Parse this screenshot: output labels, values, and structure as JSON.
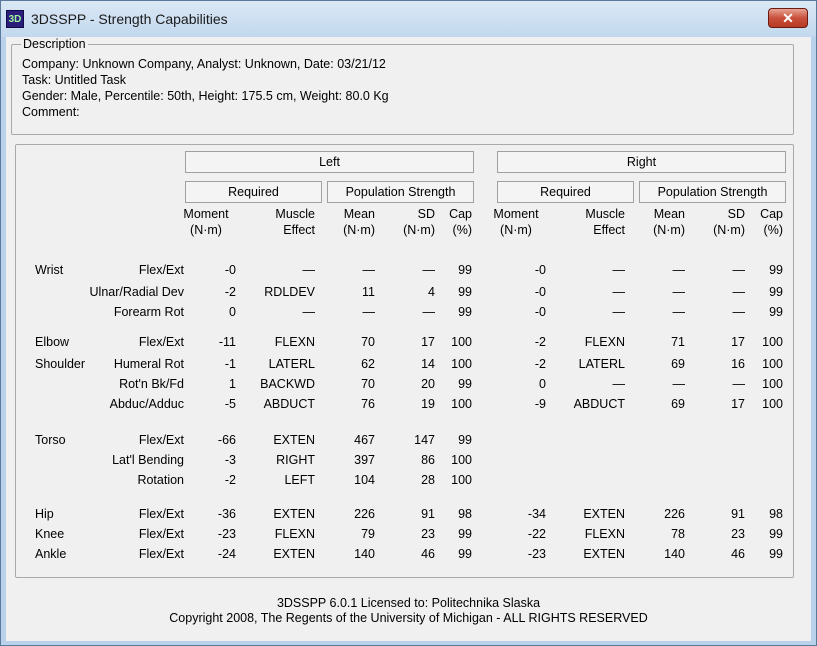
{
  "window": {
    "icon_text": "3D",
    "title": "3DSSPP - Strength Capabilities",
    "close_glyph": "✕"
  },
  "description": {
    "legend": "Description",
    "company_line": "Company: Unknown Company, Analyst: Unknown, Date: 03/21/12",
    "task_line": "Task: Untitled Task",
    "gender_line": "Gender: Male, Percentile: 50th, Height: 175.5 cm, Weight: 80.0 Kg",
    "comment_line": "Comment:"
  },
  "table": {
    "left_label": "Left",
    "right_label": "Right",
    "required_label": "Required",
    "population_label": "Population Strength",
    "col_headers": [
      [
        "Moment",
        "(N·m)"
      ],
      [
        "Muscle",
        "Effect"
      ],
      [
        "Mean",
        "(N·m)"
      ],
      [
        "SD",
        "(N·m)"
      ],
      [
        "Cap",
        "(%)"
      ]
    ],
    "rows": [
      {
        "joint": "Wrist",
        "motion": "Flex/Ext",
        "left": [
          "-0",
          "—",
          "—",
          "—",
          "99"
        ],
        "right": [
          "-0",
          "—",
          "—",
          "—",
          "99"
        ]
      },
      {
        "joint": "",
        "motion": "Ulnar/Radial Dev",
        "left": [
          "-2",
          "RDLDEV",
          "11",
          "4",
          "99"
        ],
        "right": [
          "-0",
          "—",
          "—",
          "—",
          "99"
        ]
      },
      {
        "joint": "",
        "motion": "Forearm Rot",
        "left": [
          "0",
          "—",
          "—",
          "—",
          "99"
        ],
        "right": [
          "-0",
          "—",
          "—",
          "—",
          "99"
        ]
      },
      {
        "joint": "Elbow",
        "motion": "Flex/Ext",
        "left": [
          "-11",
          "FLEXN",
          "70",
          "17",
          "100"
        ],
        "right": [
          "-2",
          "FLEXN",
          "71",
          "17",
          "100"
        ]
      },
      {
        "joint": "Shoulder",
        "motion": "Humeral Rot",
        "left": [
          "-1",
          "LATERL",
          "62",
          "14",
          "100"
        ],
        "right": [
          "-2",
          "LATERL",
          "69",
          "16",
          "100"
        ]
      },
      {
        "joint": "",
        "motion": "Rot'n Bk/Fd",
        "left": [
          "1",
          "BACKWD",
          "70",
          "20",
          "99"
        ],
        "right": [
          "0",
          "—",
          "—",
          "—",
          "100"
        ]
      },
      {
        "joint": "",
        "motion": "Abduc/Adduc",
        "left": [
          "-5",
          "ABDUCT",
          "76",
          "19",
          "100"
        ],
        "right": [
          "-9",
          "ABDUCT",
          "69",
          "17",
          "100"
        ]
      },
      {
        "joint": "Torso",
        "motion": "Flex/Ext",
        "left": [
          "-66",
          "EXTEN",
          "467",
          "147",
          "99"
        ],
        "right": [
          "",
          "",
          "",
          "",
          ""
        ]
      },
      {
        "joint": "",
        "motion": "Lat'l Bending",
        "left": [
          "-3",
          "RIGHT",
          "397",
          "86",
          "100"
        ],
        "right": [
          "",
          "",
          "",
          "",
          ""
        ]
      },
      {
        "joint": "",
        "motion": "Rotation",
        "left": [
          "-2",
          "LEFT",
          "104",
          "28",
          "100"
        ],
        "right": [
          "",
          "",
          "",
          "",
          ""
        ]
      },
      {
        "joint": "Hip",
        "motion": "Flex/Ext",
        "left": [
          "-36",
          "EXTEN",
          "226",
          "91",
          "98"
        ],
        "right": [
          "-34",
          "EXTEN",
          "226",
          "91",
          "98"
        ]
      },
      {
        "joint": "Knee",
        "motion": "Flex/Ext",
        "left": [
          "-23",
          "FLEXN",
          "79",
          "23",
          "99"
        ],
        "right": [
          "-22",
          "FLEXN",
          "78",
          "23",
          "99"
        ]
      },
      {
        "joint": "Ankle",
        "motion": "Flex/Ext",
        "left": [
          "-24",
          "EXTEN",
          "140",
          "46",
          "99"
        ],
        "right": [
          "-23",
          "EXTEN",
          "140",
          "46",
          "99"
        ]
      }
    ]
  },
  "footer": {
    "license_line": "3DSSPP 6.0.1 Licensed to: Politechnika Slaska",
    "copyright_line": "Copyright 2008, The Regents of the University of Michigan - ALL RIGHTS RESERVED"
  }
}
